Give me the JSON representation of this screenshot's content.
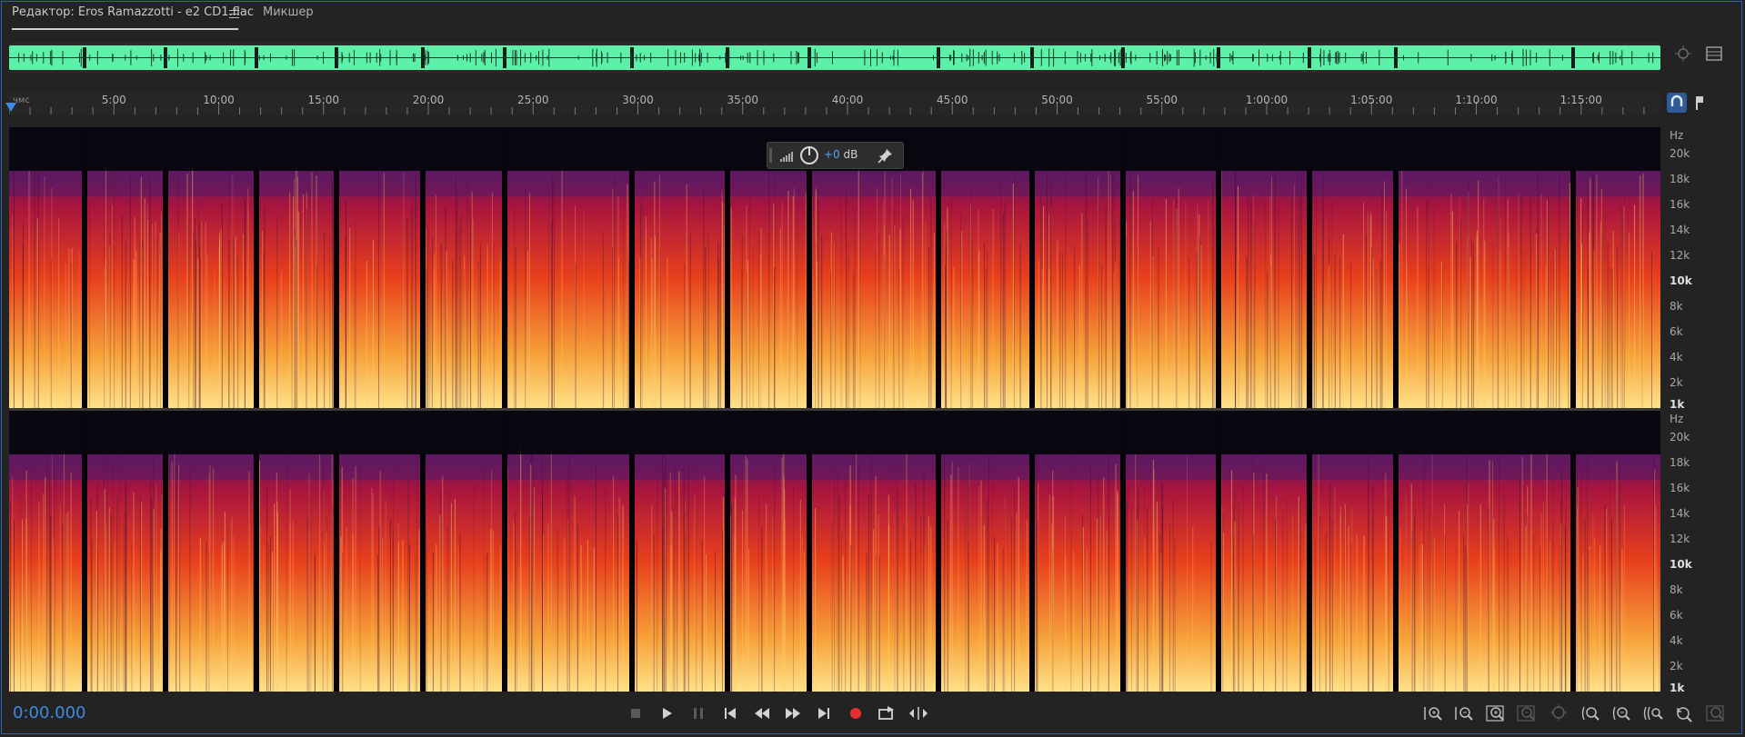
{
  "tabs": {
    "editor_label": "Редактор: Eros Ramazzotti - e2 CD1.flac",
    "mixer_label": "Микшер"
  },
  "ruler": {
    "unit": "чмс",
    "ticks": [
      "5:00",
      "10:00",
      "15:00",
      "20:00",
      "25:00",
      "30:00",
      "35:00",
      "40:00",
      "45:00",
      "50:00",
      "55:00",
      "1:00:00",
      "1:05:00",
      "1:10:00",
      "1:15:00"
    ]
  },
  "spectral": {
    "unit": "Hz",
    "labels": [
      "20k",
      "18k",
      "16k",
      "14k",
      "12k",
      "10k",
      "8k",
      "6k",
      "4k",
      "2k",
      "1k"
    ]
  },
  "hud": {
    "gain_value": "+0",
    "gain_unit": "dB"
  },
  "transport": {
    "time": "0:00.000"
  },
  "colors": {
    "accent": "#3f8ae0",
    "waveform": "#5ef0a8",
    "record": "#e53030",
    "spec_hot": "#ffe28a",
    "spec_mid": "#e8401c",
    "spec_cool": "#5b1a63"
  },
  "icons": {
    "overview_zoom": "crosshair-zoom-icon",
    "panel_menu": "panel-menu-icon",
    "snap": "snap-magnet-icon",
    "marker": "marker-pin-icon",
    "hud_meter": "level-meter-icon",
    "hud_knob": "gain-knob-icon",
    "hud_pin": "pin-icon"
  }
}
